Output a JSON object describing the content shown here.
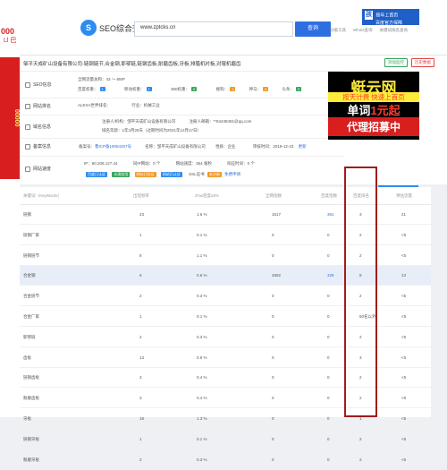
{
  "left_ad": {
    "number": "000",
    "tag": "Ll 巴",
    "text": "00000"
  },
  "topbar": {
    "logo_icon": "S",
    "logo_text": "SEO综合查询",
    "search_value": "www.zptcks.cn",
    "search_button": "查询",
    "links": [
      "旧版工具",
      "Whois查询",
      "关键词排名查询"
    ],
    "corner_ad_icon": "孩",
    "corner_ad_line1": "按年上首页",
    "corner_ad_line2": "百度官方保障"
  },
  "panel": {
    "title": "邹平天成矿山设备有限公司-链钢链节,合金钢,耶鄂链,链钢齿板,耐磨齿板,牙板,排腊机衬板,对辊机磨齿",
    "buttons": [
      "添加监控",
      "历史数据"
    ],
    "seo": {
      "label": "SEO信息",
      "r1_prefix": "全网流量总和：",
      "r1_value": "43 ～ 89IP",
      "r2": [
        {
          "k": "百度权重：",
          "v": "1"
        },
        {
          "k": "移动权重：",
          "v": "1"
        },
        {
          "k": "360权重：",
          "v": "0"
        },
        {
          "k": "搜狗：",
          "v": "1"
        },
        {
          "k": "神马：",
          "v": "0"
        },
        {
          "k": "头条：",
          "v": "0"
        }
      ]
    },
    "rank": {
      "label": "网站排名",
      "alexa": "ALEXA世界排名：",
      "category_prefix": "行业：",
      "category": "机械工业"
    },
    "domain": {
      "label": "域名信息",
      "r1_owner_k": "注册人/机构：",
      "r1_owner_v": "邹平天成矿山设备有限公司",
      "r1_mail_k": "注册人邮箱：",
      "r1_mail_v": "**84438481@qq.com",
      "r2_age_k": "域名年龄：",
      "r2_age_v": "1年3月28天（过期时间为2021年12月17日）"
    },
    "icp": {
      "label": "备案信息",
      "no_k": "备案号：",
      "no_v": "鲁ICP备19064257号",
      "name_k": "名称：",
      "name_v": "邹平天成矿山设备有限公司",
      "type_k": "性质：",
      "type_v": "企业",
      "date_k": "审核时间：",
      "date_v": "2019-12-23",
      "refresh": "更新"
    },
    "server": {
      "label": "网站速度",
      "ip_k": "IP：",
      "ip_v": "60.208.127.44",
      "same_k": "同IP网站：",
      "same_v": "0 个",
      "speed_k": "网站速度：",
      "speed_v": "364 毫秒",
      "resp_k": "响应时间：",
      "resp_v": "0 个",
      "r2": [
        "百度已认证",
        "水滴信用",
        "网站已验证",
        "网站已认证",
        "SSL证书",
        "未注册",
        "免费申请"
      ]
    }
  },
  "ad_box": {
    "l1": "蜓云网",
    "l2": "按天计费 快速上首页",
    "l3a": "单词",
    "l3b": "1元起",
    "l4": "代理招募中"
  },
  "table": {
    "headers": [
      "关键词（KeyWords）",
      "出现频率",
      "2%≤密度≤8%",
      "全网指数",
      "百度指数",
      "百度排名",
      "预估流量"
    ],
    "rows": [
      {
        "kw": "链钢",
        "freq": "23",
        "dens": "1.6 %",
        "idx": "1517",
        "bidx": "391",
        "rank": "3",
        "flow": "21",
        "hl": false
      },
      {
        "kw": "链钢厂家",
        "freq": "1",
        "dens": "0.1 %",
        "idx": "0",
        "bidx": "0",
        "rank": "2",
        "flow": "<5",
        "hl": false
      },
      {
        "kw": "链钢链节",
        "freq": "8",
        "dens": "1.1 %",
        "idx": "0",
        "bidx": "0",
        "rank": "2",
        "flow": "<5",
        "hl": false
      },
      {
        "kw": "合金钢",
        "freq": "6",
        "dens": "0.6 %",
        "idx": "4592",
        "bidx": "328",
        "rank": "8",
        "flow": "13",
        "hl": true
      },
      {
        "kw": "合金链节",
        "freq": "2",
        "dens": "0.3 %",
        "idx": "0",
        "bidx": "0",
        "rank": "2",
        "flow": "<5",
        "hl": false
      },
      {
        "kw": "合金厂家",
        "freq": "1",
        "dens": "0.1 %",
        "idx": "0",
        "bidx": "0",
        "rank": "50名以外",
        "flow": "<5",
        "hl": false
      },
      {
        "kw": "耶鄂链",
        "freq": "2",
        "dens": "0.3 %",
        "idx": "0",
        "bidx": "0",
        "rank": "2",
        "flow": "<5",
        "hl": false
      },
      {
        "kw": "齿板",
        "freq": "13",
        "dens": "0.9 %",
        "idx": "0",
        "bidx": "0",
        "rank": "3",
        "flow": "<5",
        "hl": false
      },
      {
        "kw": "链钢齿板",
        "freq": "3",
        "dens": "0.4 %",
        "idx": "0",
        "bidx": "0",
        "rank": "2",
        "flow": "<5",
        "hl": false
      },
      {
        "kw": "耐磨齿板",
        "freq": "3",
        "dens": "0.4 %",
        "idx": "0",
        "bidx": "0",
        "rank": "2",
        "flow": "<5",
        "hl": false
      },
      {
        "kw": "牙板",
        "freq": "18",
        "dens": "1.3 %",
        "idx": "0",
        "bidx": "0",
        "rank": "1",
        "flow": "<5",
        "hl": false
      },
      {
        "kw": "链钢牙板",
        "freq": "1",
        "dens": "0.1 %",
        "idx": "0",
        "bidx": "0",
        "rank": "2",
        "flow": "<5",
        "hl": false
      },
      {
        "kw": "耐磨牙板",
        "freq": "2",
        "dens": "0.3 %",
        "idx": "0",
        "bidx": "0",
        "rank": "2",
        "flow": "<5",
        "hl": false
      }
    ]
  }
}
